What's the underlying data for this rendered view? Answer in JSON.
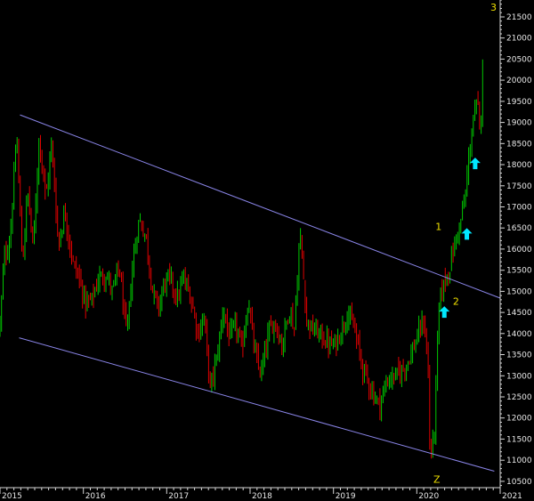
{
  "chart_data": {
    "type": "candlestick",
    "title": "",
    "xlabel": "",
    "ylabel": "",
    "x_ticks": [
      "2015",
      "2016",
      "2017",
      "2018",
      "2019",
      "2020",
      "2021"
    ],
    "y_ticks": [
      10500,
      11000,
      11500,
      12000,
      12500,
      13000,
      13500,
      14000,
      14500,
      15000,
      15500,
      16000,
      16500,
      17000,
      17500,
      18000,
      18500,
      19000,
      19500,
      20000,
      20500,
      21000,
      21500
    ],
    "xlim": [
      2015.0,
      2021.0
    ],
    "ylim": [
      10350,
      21900
    ],
    "grid": false,
    "colors": {
      "up": "#00c800",
      "down": "#e00000",
      "channel": "#8a85e8",
      "wave_label": "#f0e000",
      "arrow": "#00e8ff"
    },
    "price_path": [
      [
        2015.0,
        14200
      ],
      [
        2015.05,
        15800
      ],
      [
        2015.12,
        16200
      ],
      [
        2015.2,
        18700
      ],
      [
        2015.27,
        15600
      ],
      [
        2015.33,
        17400
      ],
      [
        2015.4,
        16000
      ],
      [
        2015.47,
        18700
      ],
      [
        2015.55,
        17200
      ],
      [
        2015.62,
        18500
      ],
      [
        2015.7,
        16100
      ],
      [
        2015.78,
        16900
      ],
      [
        2015.87,
        15700
      ],
      [
        2015.95,
        15300
      ],
      [
        2016.03,
        14700
      ],
      [
        2016.1,
        14800
      ],
      [
        2016.18,
        15300
      ],
      [
        2016.27,
        15400
      ],
      [
        2016.35,
        15000
      ],
      [
        2016.43,
        15600
      ],
      [
        2016.52,
        13900
      ],
      [
        2016.6,
        15800
      ],
      [
        2016.67,
        16700
      ],
      [
        2016.75,
        16300
      ],
      [
        2016.83,
        15000
      ],
      [
        2016.9,
        14600
      ],
      [
        2016.97,
        15200
      ],
      [
        2017.05,
        15300
      ],
      [
        2017.12,
        14800
      ],
      [
        2017.2,
        15300
      ],
      [
        2017.28,
        14900
      ],
      [
        2017.38,
        14000
      ],
      [
        2017.45,
        14400
      ],
      [
        2017.52,
        12700
      ],
      [
        2017.6,
        13400
      ],
      [
        2017.68,
        14600
      ],
      [
        2017.75,
        13900
      ],
      [
        2017.83,
        14200
      ],
      [
        2017.9,
        13600
      ],
      [
        2017.98,
        14800
      ],
      [
        2018.05,
        13600
      ],
      [
        2018.13,
        13000
      ],
      [
        2018.22,
        14000
      ],
      [
        2018.3,
        14300
      ],
      [
        2018.38,
        13700
      ],
      [
        2018.47,
        14600
      ],
      [
        2018.53,
        14100
      ],
      [
        2018.6,
        16400
      ],
      [
        2018.68,
        14300
      ],
      [
        2018.75,
        14100
      ],
      [
        2018.83,
        14000
      ],
      [
        2018.92,
        13800
      ],
      [
        2019.0,
        13700
      ],
      [
        2019.08,
        14000
      ],
      [
        2019.17,
        14500
      ],
      [
        2019.25,
        14100
      ],
      [
        2019.35,
        13200
      ],
      [
        2019.45,
        12700
      ],
      [
        2019.55,
        12300
      ],
      [
        2019.65,
        12900
      ],
      [
        2019.75,
        13000
      ],
      [
        2019.85,
        13200
      ],
      [
        2019.95,
        13600
      ],
      [
        2020.02,
        14000
      ],
      [
        2020.08,
        14300
      ],
      [
        2020.13,
        13500
      ],
      [
        2020.16,
        11000
      ],
      [
        2020.21,
        11700
      ],
      [
        2020.27,
        14800
      ],
      [
        2020.33,
        15200
      ],
      [
        2020.4,
        15600
      ],
      [
        2020.45,
        16100
      ],
      [
        2020.52,
        16600
      ],
      [
        2020.58,
        17200
      ],
      [
        2020.63,
        18300
      ],
      [
        2020.68,
        19100
      ],
      [
        2020.73,
        19500
      ],
      [
        2020.76,
        18500
      ],
      [
        2020.79,
        20600
      ]
    ],
    "channel_lines": [
      {
        "name": "upper",
        "from": [
          2015.24,
          19180
        ],
        "to": [
          2021.0,
          14840
        ]
      },
      {
        "name": "lower",
        "from": [
          2015.23,
          13900
        ],
        "to": [
          2020.93,
          10740
        ]
      }
    ],
    "annotations": [
      {
        "text": "3",
        "x": 2020.92,
        "y": 21650
      },
      {
        "text": "1",
        "x": 2020.26,
        "y": 16450
      },
      {
        "text": "2",
        "x": 2020.47,
        "y": 14680
      },
      {
        "text": "Z",
        "x": 2020.24,
        "y": 10470
      }
    ],
    "arrows": [
      {
        "x": 2020.33,
        "y": 14500
      },
      {
        "x": 2020.6,
        "y": 16350
      },
      {
        "x": 2020.7,
        "y": 18020
      }
    ]
  }
}
